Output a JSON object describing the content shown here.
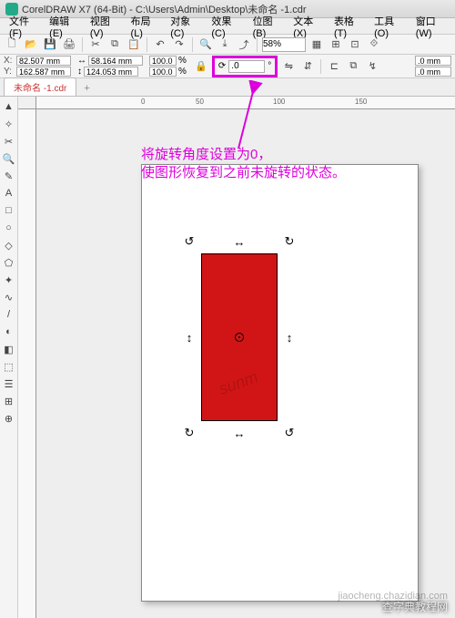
{
  "title": "CorelDRAW X7 (64-Bit) - C:\\Users\\Admin\\Desktop\\未命名 -1.cdr",
  "menu": [
    "文件(F)",
    "编辑(E)",
    "视图(V)",
    "布局(L)",
    "对象(C)",
    "效果(C)",
    "位图(B)",
    "文本(X)",
    "表格(T)",
    "工具(O)",
    "窗口(W)"
  ],
  "zoom": "58%",
  "coords": {
    "x_label": "X:",
    "x": "82.507 mm",
    "y_label": "Y:",
    "y": "162.587 mm",
    "w": "58.164 mm",
    "h": "124.053 mm",
    "sx": "100.0",
    "sy": "100.0",
    "pct": "%"
  },
  "rotation": {
    "value": ".0",
    "unit": "°"
  },
  "outline": {
    "a": ".0 mm",
    "b": ".0 mm"
  },
  "tab": {
    "name": "未命名 -1.cdr",
    "add": "+"
  },
  "ruler_marks": [
    "0",
    "50",
    "100",
    "150"
  ],
  "annotation_l1": "将旋转角度设置为0，",
  "annotation_l2": "使图形恢复到之前未旋转的状态。",
  "watermark_main": "查字典教程网",
  "watermark_url": "jiaocheng.chazidian.com",
  "watermark_diag": "sunm",
  "icons": {
    "new": "🗋",
    "open": "📂",
    "save": "💾",
    "print": "🖨",
    "cut": "✂",
    "copy": "⧉",
    "paste": "📋",
    "undo": "↶",
    "redo": "↷",
    "import": "⤓",
    "export": "⤴",
    "search": "🔍"
  },
  "tools": [
    "▲",
    "✧",
    "✂",
    "🔍",
    "✎",
    "A",
    "□",
    "○",
    "◇",
    "⬠",
    "✦",
    "∿",
    "/",
    "◐",
    "◧",
    "⬚",
    "☰",
    "⊞",
    "⊕"
  ]
}
